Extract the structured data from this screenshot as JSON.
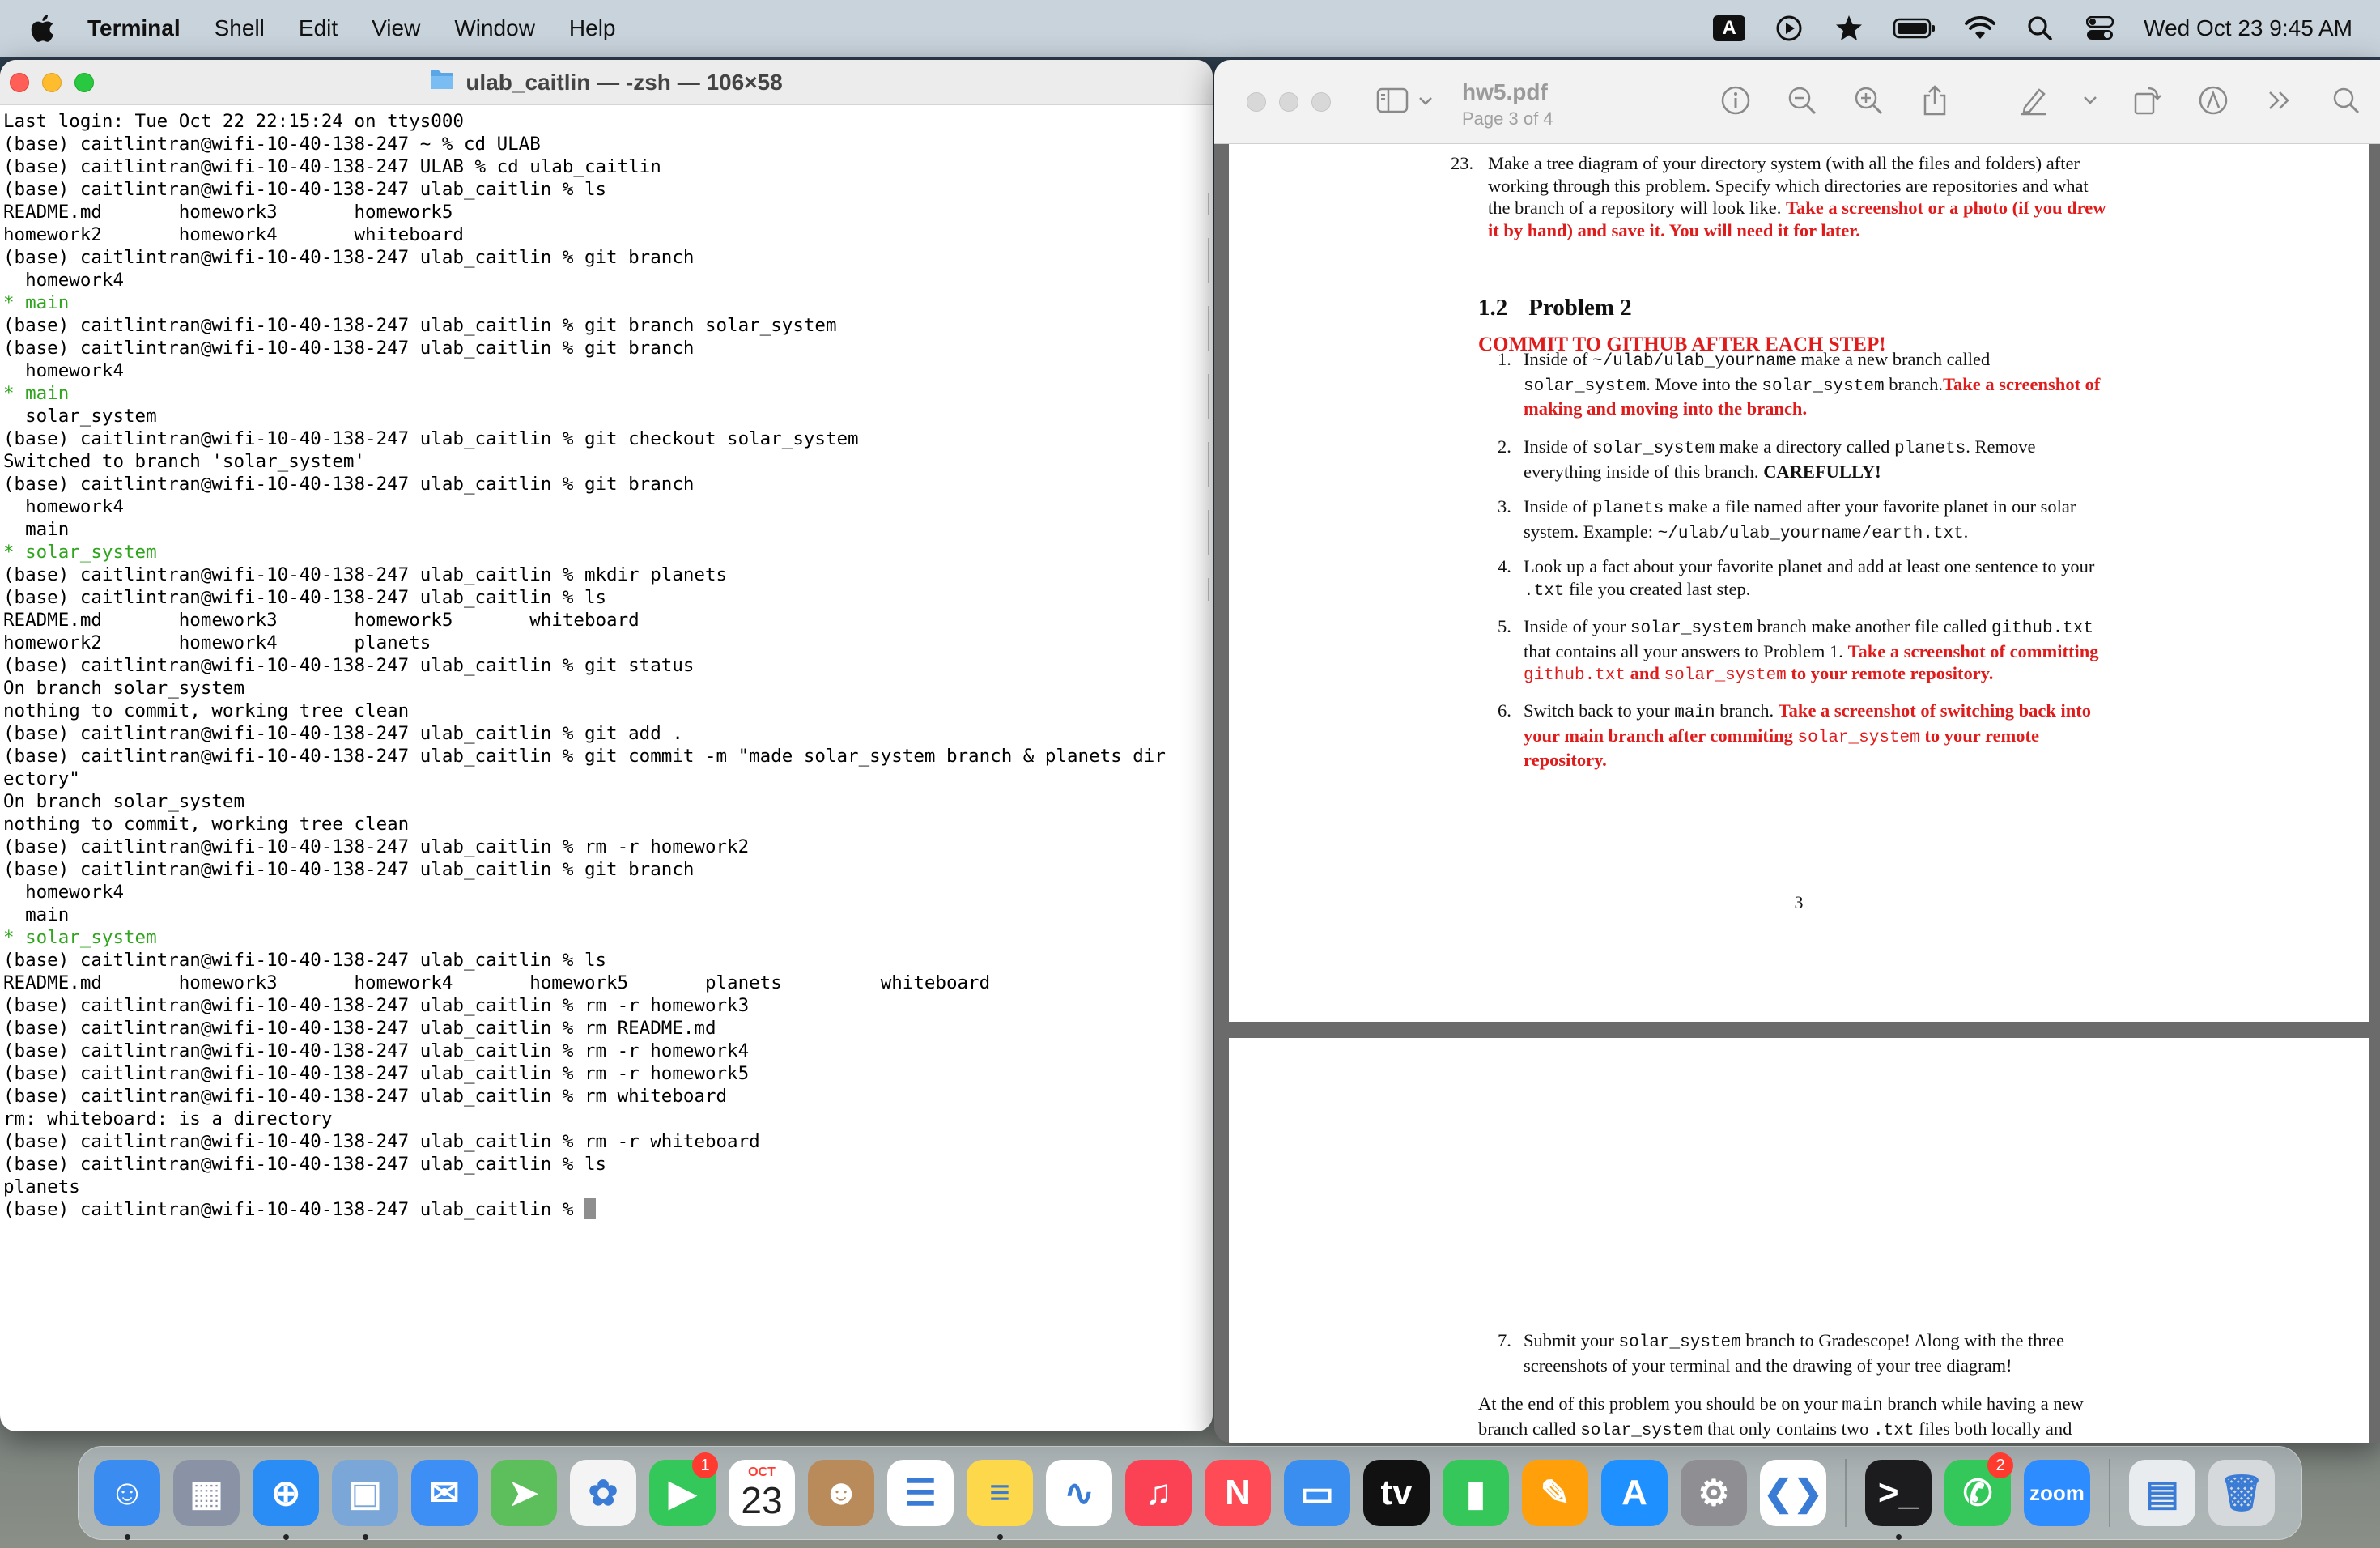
{
  "menubar": {
    "app_name": "Terminal",
    "items": [
      "Shell",
      "Edit",
      "View",
      "Window",
      "Help"
    ],
    "input_indicator": "A",
    "clock": "Wed Oct 23  9:45 AM"
  },
  "terminal": {
    "title": "ulab_caitlin — -zsh — 106×58",
    "lines": [
      {
        "t": "Last login: Tue Oct 22 22:15:24 on ttys000"
      },
      {
        "t": "(base) caitlintran@wifi-10-40-138-247 ~ % cd ULAB"
      },
      {
        "t": "(base) caitlintran@wifi-10-40-138-247 ULAB % cd ulab_caitlin"
      },
      {
        "t": "(base) caitlintran@wifi-10-40-138-247 ulab_caitlin % ls"
      },
      {
        "t": "README.md       homework3       homework5"
      },
      {
        "t": "homework2       homework4       whiteboard"
      },
      {
        "t": "(base) caitlintran@wifi-10-40-138-247 ulab_caitlin % git branch"
      },
      {
        "t": "  homework4"
      },
      {
        "t": "* main",
        "green": true
      },
      {
        "t": "(base) caitlintran@wifi-10-40-138-247 ulab_caitlin % git branch solar_system"
      },
      {
        "t": "(base) caitlintran@wifi-10-40-138-247 ulab_caitlin % git branch"
      },
      {
        "t": "  homework4"
      },
      {
        "t": "* main",
        "green": true
      },
      {
        "t": "  solar_system"
      },
      {
        "t": "(base) caitlintran@wifi-10-40-138-247 ulab_caitlin % git checkout solar_system"
      },
      {
        "t": "Switched to branch 'solar_system'"
      },
      {
        "t": "(base) caitlintran@wifi-10-40-138-247 ulab_caitlin % git branch"
      },
      {
        "t": "  homework4"
      },
      {
        "t": "  main"
      },
      {
        "t": "* solar_system",
        "green": true
      },
      {
        "t": "(base) caitlintran@wifi-10-40-138-247 ulab_caitlin % mkdir planets"
      },
      {
        "t": "(base) caitlintran@wifi-10-40-138-247 ulab_caitlin % ls"
      },
      {
        "t": "README.md       homework3       homework5       whiteboard"
      },
      {
        "t": "homework2       homework4       planets"
      },
      {
        "t": "(base) caitlintran@wifi-10-40-138-247 ulab_caitlin % git status"
      },
      {
        "t": "On branch solar_system"
      },
      {
        "t": "nothing to commit, working tree clean"
      },
      {
        "t": "(base) caitlintran@wifi-10-40-138-247 ulab_caitlin % git add ."
      },
      {
        "t": "(base) caitlintran@wifi-10-40-138-247 ulab_caitlin % git commit -m \"made solar_system branch & planets dir"
      },
      {
        "t": "ectory\""
      },
      {
        "t": "On branch solar_system"
      },
      {
        "t": "nothing to commit, working tree clean"
      },
      {
        "t": "(base) caitlintran@wifi-10-40-138-247 ulab_caitlin % rm -r homework2"
      },
      {
        "t": "(base) caitlintran@wifi-10-40-138-247 ulab_caitlin % git branch"
      },
      {
        "t": "  homework4"
      },
      {
        "t": "  main"
      },
      {
        "t": "* solar_system",
        "green": true
      },
      {
        "t": "(base) caitlintran@wifi-10-40-138-247 ulab_caitlin % ls"
      },
      {
        "t": "README.md       homework3       homework4       homework5       planets         whiteboard"
      },
      {
        "t": "(base) caitlintran@wifi-10-40-138-247 ulab_caitlin % rm -r homework3"
      },
      {
        "t": "(base) caitlintran@wifi-10-40-138-247 ulab_caitlin % rm README.md"
      },
      {
        "t": "(base) caitlintran@wifi-10-40-138-247 ulab_caitlin % rm -r homework4"
      },
      {
        "t": "(base) caitlintran@wifi-10-40-138-247 ulab_caitlin % rm -r homework5"
      },
      {
        "t": "(base) caitlintran@wifi-10-40-138-247 ulab_caitlin % rm whiteboard"
      },
      {
        "t": "rm: whiteboard: is a directory"
      },
      {
        "t": "(base) caitlintran@wifi-10-40-138-247 ulab_caitlin % rm -r whiteboard"
      },
      {
        "t": "(base) caitlintran@wifi-10-40-138-247 ulab_caitlin % ls"
      },
      {
        "t": "planets"
      }
    ],
    "prompt": "(base) caitlintran@wifi-10-40-138-247 ulab_caitlin % "
  },
  "preview": {
    "filename": "hw5.pdf",
    "page_indicator": "Page 3 of 4",
    "page3": {
      "item23_num": "23.",
      "item23_text": "Make a tree diagram of your directory system (with all the files and folders) after working through this problem. Specify which directories are repositories and what the branch of a repository will look like. ",
      "item23_red": "Take a screenshot or a photo (if you drew it by hand) and save it. You will need it for later.",
      "section_num": "1.2",
      "section_title": "Problem 2",
      "commit_heading": "COMMIT TO GITHUB AFTER EACH STEP!",
      "s1": {
        "num": "1.",
        "a": "Inside of ",
        "b": "~/ulab/ulab_yourname",
        "c": " make a new branch called ",
        "d": "solar_system",
        "e": ". Move into the ",
        "f": "solar_system",
        "g": " branch.",
        "red": "Take a screenshot of making and moving into the branch."
      },
      "s2": {
        "num": "2.",
        "a": "Inside of ",
        "b": "solar_system",
        "c": " make a directory called ",
        "d": "planets",
        "e": ". Remove everything inside of this branch. ",
        "bold": "CAREFULLY!"
      },
      "s3": {
        "num": "3.",
        "a": "Inside of ",
        "b": "planets",
        "c": " make a file named after your favorite planet in our solar system. Example: ",
        "d": "~/ulab/ulab_yourname/earth.txt",
        "e": "."
      },
      "s4": {
        "num": "4.",
        "a": "Look up a fact about your favorite planet and add at least one sentence to your ",
        "b": ".txt",
        "c": " file you created last step."
      },
      "s5": {
        "num": "5.",
        "a": "Inside of your ",
        "b": "solar_system",
        "c": " branch make another file called ",
        "d": "github.txt",
        "e": " that contains all your answers to Problem 1. ",
        "red1": "Take a screenshot of committing ",
        "rm1": "github.txt",
        "red2": " and ",
        "rm2": "solar_system",
        "red3": " to your remote repository."
      },
      "s6": {
        "num": "6.",
        "a": "Switch back to your ",
        "b": "main",
        "c": " branch. ",
        "red1": "Take a screenshot of switching back into your main branch after commiting ",
        "rm1": "solar_system",
        "red2": " to your remote repository."
      },
      "page_number": "3"
    },
    "page4": {
      "s7": {
        "num": "7.",
        "a": "Submit your ",
        "b": "solar_system",
        "c": " branch to Gradescope! Along with the three screenshots of your terminal and the drawing of your tree diagram!"
      },
      "para": {
        "a": "At the end of this problem you should be on your ",
        "b": "main",
        "c": " branch while having a new branch called ",
        "d": "solar_system",
        "e": " that only contains two ",
        "f": ".txt",
        "g": " files both locally and remotely."
      }
    }
  },
  "dock": {
    "apps": [
      {
        "name": "finder",
        "color": "#3b8cf0",
        "glyph": "☺",
        "running": true
      },
      {
        "name": "launchpad",
        "color": "#8a93a6",
        "glyph": "▦"
      },
      {
        "name": "safari",
        "color": "#2a8cf5",
        "glyph": "⊕",
        "running": true
      },
      {
        "name": "preview",
        "color": "#7aa6d8",
        "glyph": "▣",
        "running": true
      },
      {
        "name": "mail",
        "color": "#3d8ef5",
        "glyph": "✉"
      },
      {
        "name": "maps",
        "color": "#5cbf5c",
        "glyph": "➤"
      },
      {
        "name": "photos",
        "color": "#f4f4f4",
        "glyph": "✿"
      },
      {
        "name": "facetime",
        "color": "#34c759",
        "glyph": "▶",
        "badge": "1"
      },
      {
        "name": "calendar",
        "color": "#ffffff",
        "cal_month": "OCT",
        "cal_day": "23"
      },
      {
        "name": "contacts",
        "color": "#b98a5a",
        "glyph": "☻"
      },
      {
        "name": "reminders",
        "color": "#ffffff",
        "glyph": "☰"
      },
      {
        "name": "notes",
        "color": "#fcd84a",
        "glyph": "≡",
        "running": true
      },
      {
        "name": "freeform",
        "color": "#ffffff",
        "glyph": "∿"
      },
      {
        "name": "music",
        "color": "#fa4254",
        "glyph": "♫"
      },
      {
        "name": "news",
        "color": "#ff4b55",
        "glyph": "N"
      },
      {
        "name": "keynote",
        "color": "#3a8ef0",
        "glyph": "▭"
      },
      {
        "name": "apple-tv",
        "color": "#111111",
        "glyph": "tv"
      },
      {
        "name": "numbers",
        "color": "#35c759",
        "glyph": "▮"
      },
      {
        "name": "pages",
        "color": "#ff9f0a",
        "glyph": "✎"
      },
      {
        "name": "app-store",
        "color": "#1e90ff",
        "glyph": "A"
      },
      {
        "name": "system-settings",
        "color": "#8e8e93",
        "glyph": "⚙"
      },
      {
        "name": "vscode",
        "color": "#ffffff",
        "glyph": "❮❯"
      }
    ],
    "apps_right": [
      {
        "name": "terminal",
        "color": "#1c1c1e",
        "glyph": ">_",
        "running": true
      },
      {
        "name": "messages",
        "color": "#34c759",
        "glyph": "✆",
        "badge": "2"
      },
      {
        "name": "zoom",
        "color": "#2d8cff",
        "glyph": "zoom"
      }
    ],
    "apps_far": [
      {
        "name": "downloads-stack",
        "color": "#e8ecef",
        "glyph": "▤"
      },
      {
        "name": "trash",
        "color": "#d5d9dc",
        "glyph": "🗑"
      }
    ]
  }
}
